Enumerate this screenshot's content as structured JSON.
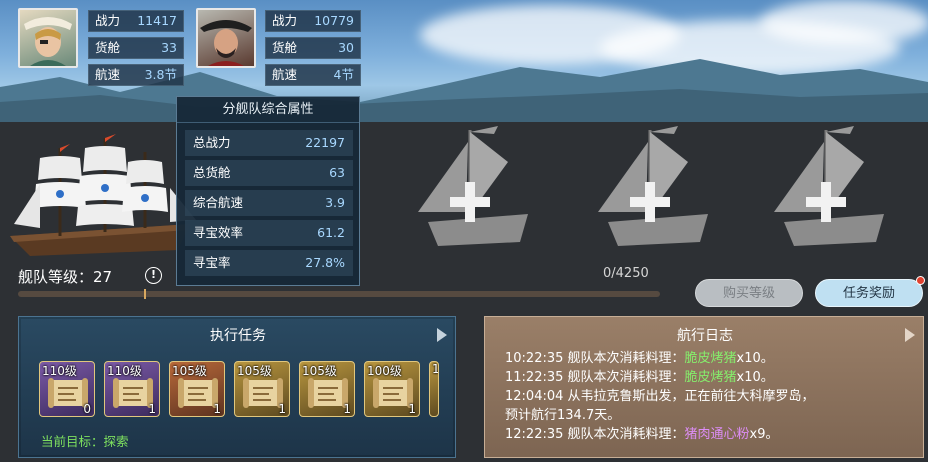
{
  "captain_left": {
    "stats": [
      {
        "label": "战力",
        "value": "11417"
      },
      {
        "label": "货舱",
        "value": "33"
      },
      {
        "label": "航速",
        "value": "3.8节"
      }
    ]
  },
  "captain_right": {
    "stats": [
      {
        "label": "战力",
        "value": "10779"
      },
      {
        "label": "货舱",
        "value": "30"
      },
      {
        "label": "航速",
        "value": "4节"
      }
    ]
  },
  "fleet_attributes": {
    "title": "分舰队综合属性",
    "rows": [
      {
        "label": "总战力",
        "value": "22197"
      },
      {
        "label": "总货舱",
        "value": "63"
      },
      {
        "label": "综合航速",
        "value": "3.9"
      },
      {
        "label": "寻宝效率",
        "value": "61.2"
      },
      {
        "label": "寻宝率",
        "value": "27.8%"
      }
    ]
  },
  "fleet": {
    "level_label": "舰队等级：",
    "level_value": "27",
    "info_icon": "!",
    "progress_text": "0/4250",
    "progress_fraction": 0.0,
    "empty_slot_icon": "plus-icon"
  },
  "buttons": {
    "buy_level": "购买等级",
    "task_reward": "任务奖励"
  },
  "tasks": {
    "title": "执行任务",
    "items": [
      {
        "level": "110级",
        "count": "0",
        "rarity": "purple"
      },
      {
        "level": "110级",
        "count": "1",
        "rarity": "purple"
      },
      {
        "level": "105级",
        "count": "1",
        "rarity": "orange"
      },
      {
        "level": "105级",
        "count": "1",
        "rarity": "gold"
      },
      {
        "level": "105级",
        "count": "1",
        "rarity": "gold"
      },
      {
        "level": "100级",
        "count": "1",
        "rarity": "gold"
      },
      {
        "level": "1",
        "count": "",
        "rarity": "gold"
      }
    ],
    "target_label": "当前目标：",
    "target_value": "探索"
  },
  "log": {
    "title": "航行日志",
    "entries": [
      {
        "time": "10:22:35",
        "text": "  舰队本次消耗料理：",
        "item": "脆皮烤猪",
        "suffix": "x10。",
        "color": "green"
      },
      {
        "time": "11:22:35",
        "text": "  舰队本次消耗料理：",
        "item": "脆皮烤猪",
        "suffix": "x10。",
        "color": "green"
      },
      {
        "time": "12:04:04",
        "text": "  从韦拉克鲁斯出发，正在前往大科摩罗岛，",
        "item": "",
        "suffix": "",
        "color": ""
      },
      {
        "time": "",
        "text": "预计航行134.7天。",
        "item": "",
        "suffix": "",
        "color": ""
      },
      {
        "time": "12:22:35",
        "text": "  舰队本次消耗料理：",
        "item": "猪肉通心粉",
        "suffix": "x9。",
        "color": "purple"
      }
    ]
  },
  "colors": {
    "stat_value": "#a8d8ff",
    "log_green": "#86ee6c",
    "log_purple": "#dc8df5",
    "target_green": "#7ee05f"
  }
}
